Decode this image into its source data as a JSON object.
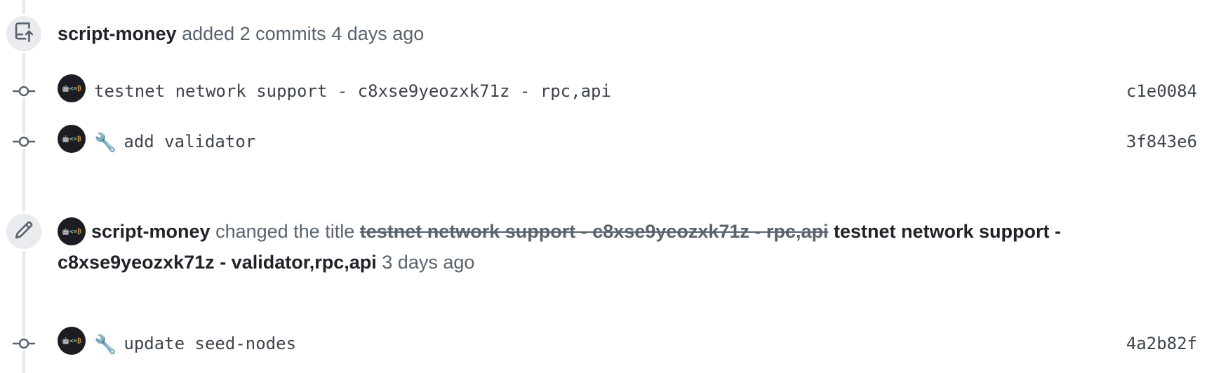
{
  "events": {
    "commits_added": {
      "author": "script-money",
      "action": "added 2 commits",
      "time": "4 days ago",
      "icon": "repo-push-icon"
    },
    "title_changed": {
      "author": "script-money",
      "action": "changed the title",
      "old_title": "testnet network support - c8xse9yeozxk71z - rpc,api",
      "new_title": "testnet network support - c8xse9yeozxk71z - validator,rpc,api",
      "time": "3 days ago",
      "icon": "pencil-icon"
    }
  },
  "commits": [
    {
      "message": "testnet network support - c8xse9yeozxk71z - rpc,api",
      "emoji": "",
      "sha": "c1e0084"
    },
    {
      "message": "add validator",
      "emoji": "🔧",
      "sha": "3f843e6"
    },
    {
      "message": "update seed-nodes",
      "emoji": "🔧",
      "sha": "4a2b82f"
    }
  ],
  "avatar": {
    "robot": "🤖",
    "operator": "<=",
    "btc": "₿"
  },
  "colors": {
    "timeline_line": "#e6e8eb",
    "badge_bg": "#e9ebee",
    "muted_text": "#59636e",
    "strong_text": "#1f2328",
    "avatar_bg": "#1b1d22"
  }
}
